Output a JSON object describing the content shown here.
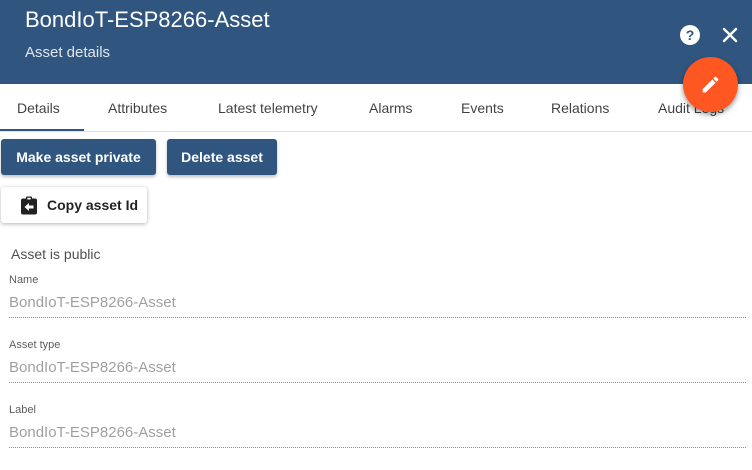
{
  "header": {
    "title": "BondIoT-ESP8266-Asset",
    "subtitle": "Asset details",
    "help_glyph": "?",
    "help_icon": "help-circle-icon",
    "close_icon": "close-icon",
    "edit_icon": "pencil-icon"
  },
  "tabs": [
    {
      "label": "Details",
      "active": true
    },
    {
      "label": "Attributes",
      "active": false
    },
    {
      "label": "Latest telemetry",
      "active": false
    },
    {
      "label": "Alarms",
      "active": false
    },
    {
      "label": "Events",
      "active": false
    },
    {
      "label": "Relations",
      "active": false
    },
    {
      "label": "Audit Logs",
      "active": false
    }
  ],
  "actions": {
    "make_private": "Make asset private",
    "delete": "Delete asset",
    "copy_id": "Copy asset Id",
    "copy_icon": "clipboard-arrow-left-icon"
  },
  "status": {
    "public_text": "Asset is public"
  },
  "fields": [
    {
      "label": "Name",
      "value": "BondIoT-ESP8266-Asset"
    },
    {
      "label": "Asset type",
      "value": "BondIoT-ESP8266-Asset"
    },
    {
      "label": "Label",
      "value": "BondIoT-ESP8266-Asset"
    }
  ],
  "colors": {
    "primary": "#305680",
    "accent": "#ff5722",
    "background": "#ffffff"
  }
}
